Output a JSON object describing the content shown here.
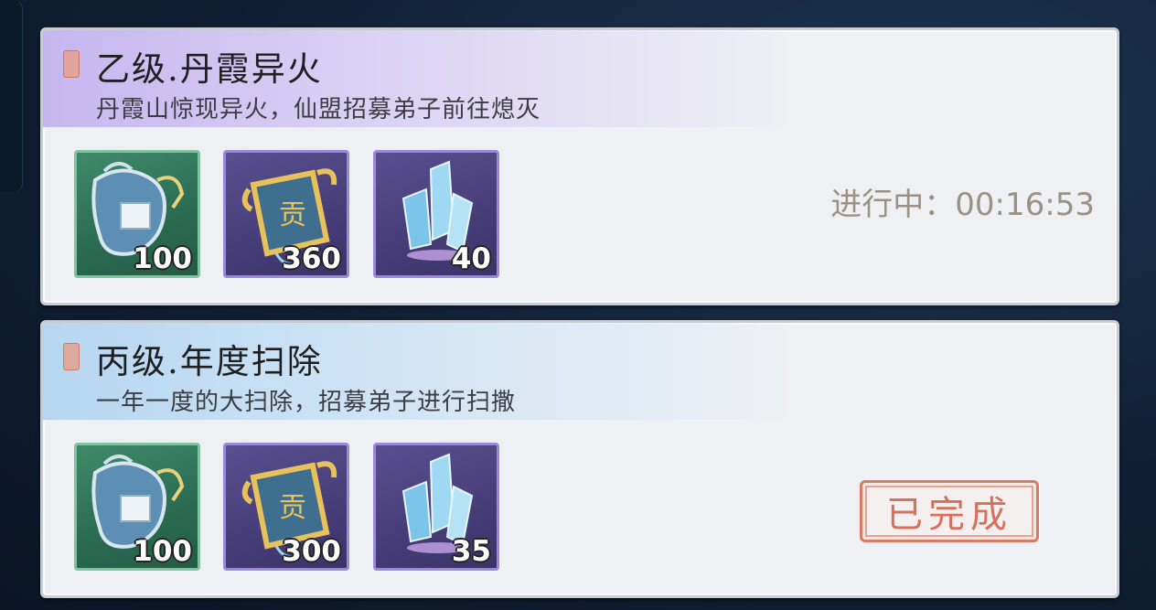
{
  "tasks": [
    {
      "title": "乙级.丹霞异火",
      "description": "丹霞山惊现异火，仙盟招募弟子前往熄灭",
      "rewards": [
        {
          "icon": "badge-reward-icon",
          "quantity": "100"
        },
        {
          "icon": "contribution-token-icon",
          "quantity": "360"
        },
        {
          "icon": "spirit-crystal-icon",
          "quantity": "40"
        }
      ],
      "status": "进行中：00:16:53"
    },
    {
      "title": "丙级.年度扫除",
      "description": "一年一度的大扫除，招募弟子进行扫撒",
      "rewards": [
        {
          "icon": "badge-reward-icon",
          "quantity": "100"
        },
        {
          "icon": "contribution-token-icon",
          "quantity": "300"
        },
        {
          "icon": "spirit-crystal-icon",
          "quantity": "35"
        }
      ],
      "status": "已完成"
    }
  ],
  "colors": {
    "header_purple": "#c6b6ef",
    "header_blue": "#b6d6f0",
    "status_text": "#9b9285",
    "completed_stamp": "#d9705b"
  }
}
